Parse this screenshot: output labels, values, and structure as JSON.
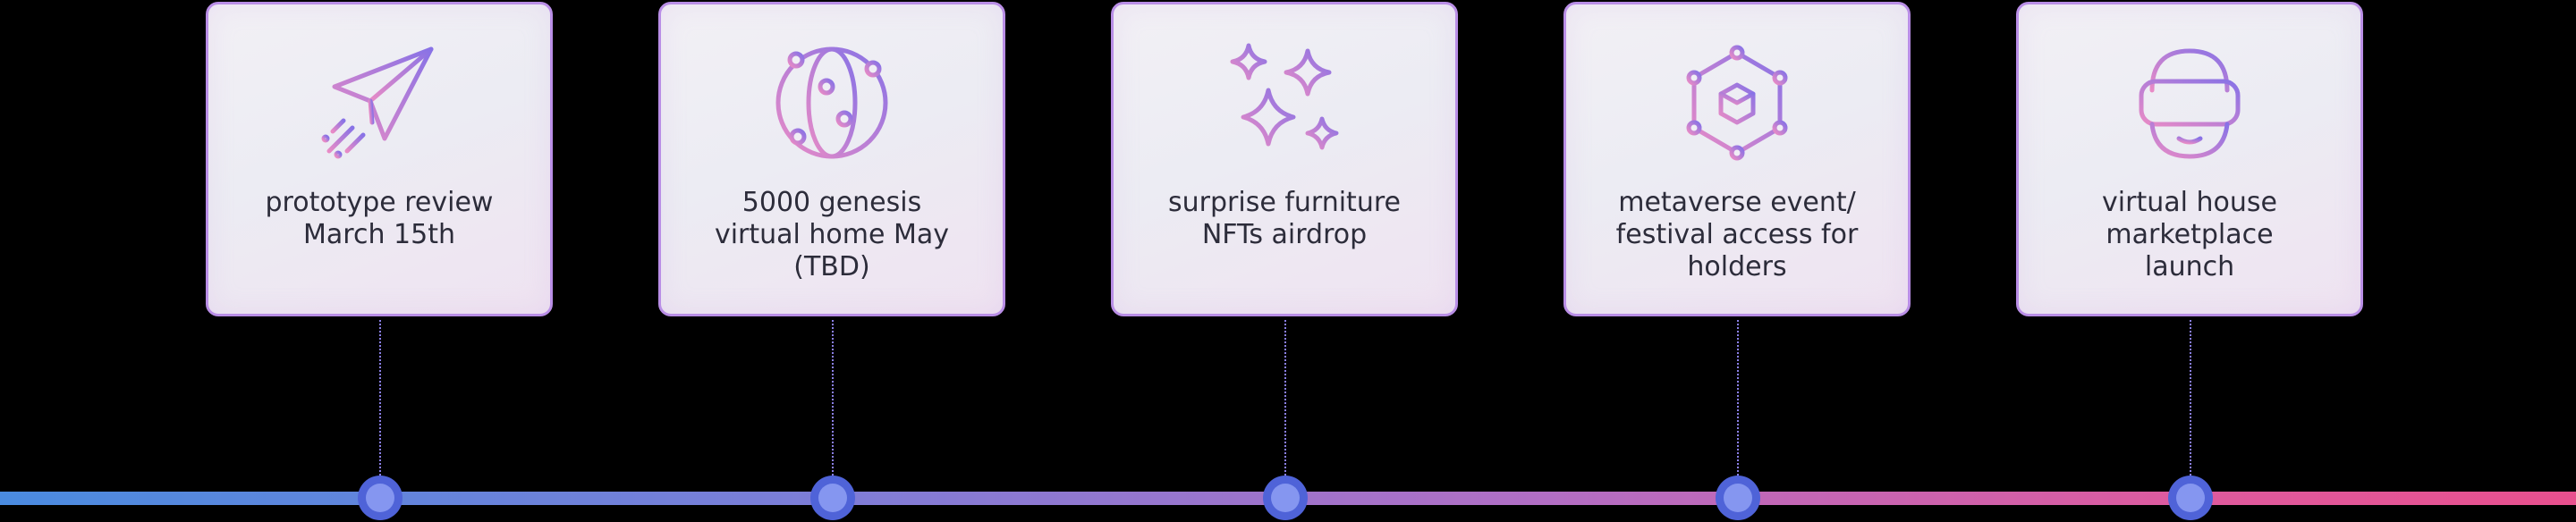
{
  "colors": {
    "background": "#000000",
    "card_border": "#b98ee6",
    "icon_gradient_start": "#e48ac8",
    "icon_gradient_end": "#8a74e6",
    "timeline_start": "#4a8be0",
    "timeline_end": "#e8508e",
    "milestone_dot": "#8596f0"
  },
  "milestones": [
    {
      "icon": "paper-plane-icon",
      "text": "prototype review\nMarch 15th"
    },
    {
      "icon": "globe-network-icon",
      "text": "5000 genesis\nvirtual home May\n(TBD)"
    },
    {
      "icon": "sparkles-icon",
      "text": "surprise furniture\nNFTs airdrop"
    },
    {
      "icon": "metaverse-cube-icon",
      "text": "metaverse event/\nfestival access for\nholders"
    },
    {
      "icon": "vr-headset-icon",
      "text": "virtual house\nmarketplace\nlaunch"
    }
  ]
}
